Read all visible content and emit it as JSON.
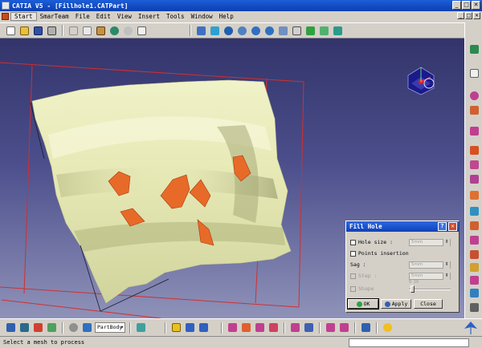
{
  "app": {
    "title": "CATIA V5 - [Fillhole1.CATPart]",
    "window_controls": [
      "_",
      "□",
      "✕"
    ],
    "doc_controls": [
      "_",
      "□",
      "✕"
    ]
  },
  "menu": {
    "items": [
      {
        "label": "Start",
        "active": true
      },
      {
        "label": "SmarTeam"
      },
      {
        "label": "File"
      },
      {
        "label": "Edit"
      },
      {
        "label": "View"
      },
      {
        "label": "Insert"
      },
      {
        "label": "Tools"
      },
      {
        "label": "Window"
      },
      {
        "label": "Help"
      }
    ]
  },
  "toolbar_top": {
    "icons": [
      "new-icon",
      "open-icon",
      "save-icon",
      "print-icon",
      "cut-icon",
      "copy-icon",
      "paste-icon",
      "undo-icon",
      "redo-icon",
      "whats-this-icon",
      "fly-mode-icon",
      "fit-all-icon",
      "pan-icon",
      "rotate-icon",
      "zoom-in-icon",
      "zoom-out-icon",
      "normal-view-icon",
      "multi-view-icon",
      "shading-icon",
      "hide-show-icon",
      "swap-space-icon"
    ]
  },
  "toolbar_bottom": {
    "part_body": "PartBody",
    "icons": [
      "measure-icon",
      "sketch-icon",
      "compass-icon",
      "sync-icon",
      "scan-icon",
      "partbody-select-icon",
      "magnet-icon",
      "snap-icon",
      "analysis-icon",
      "cut-plane-icon",
      "offset-icon",
      "fill-hole-icon",
      "mesh-icon",
      "curvature-icon",
      "warning-icon",
      "catia-logo"
    ]
  },
  "toolbar_right": {
    "icons": [
      "select-icon",
      "pointer-icon",
      "cloud-icon",
      "cross-section-icon",
      "mesh-cleaner-icon",
      "fill-hole-tool-icon",
      "smooth-icon",
      "decimate-icon",
      "merge-icon",
      "split-icon",
      "offset-mesh-icon",
      "flip-icon",
      "shape-icon",
      "scan-on-part-icon",
      "edge-icon",
      "analysis-tool-icon",
      "query-icon",
      "export-icon"
    ]
  },
  "dialog": {
    "title": "Fill Hole",
    "help_btn": "?",
    "close_btn": "✕",
    "hole_size_label": "Hole size :",
    "hole_size_value": "5mm",
    "points_insertion_label": "Points insertion",
    "sag_label": "Sag :",
    "sag_value": "5mm",
    "step_label": "Step :",
    "step_value": "5mm",
    "shape_label": "Shape",
    "shape_scale_label": "0   10",
    "ok_label": "OK",
    "apply_label": "Apply",
    "close_label": "Close"
  },
  "status": {
    "message": "Select a mesh to process"
  },
  "colors": {
    "title_bar": "#0a3fb0",
    "viewport_top": "#33346b",
    "viewport_bottom": "#8f92b8",
    "model": "#e6e8b0",
    "hole_patch": "#e86a28",
    "bounding_box": "#d03030"
  }
}
